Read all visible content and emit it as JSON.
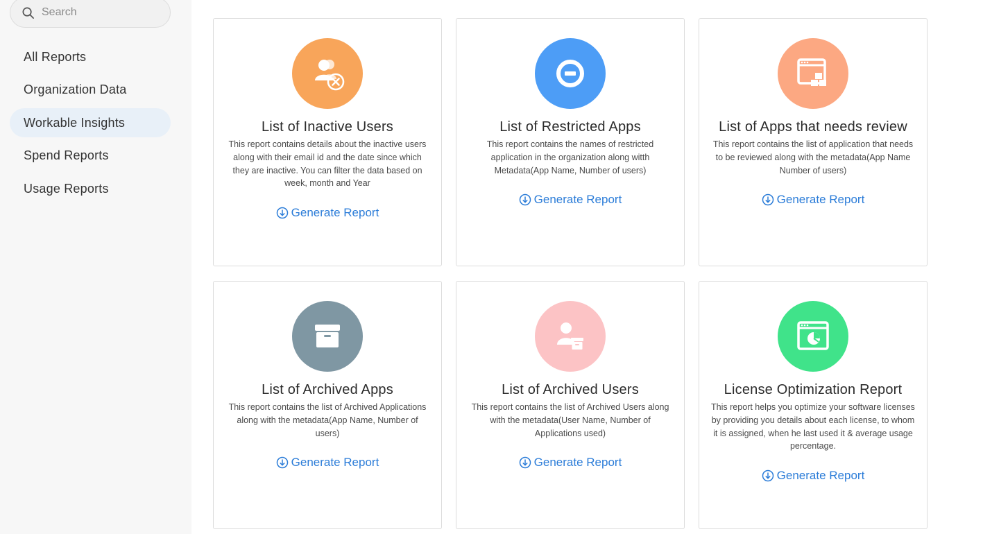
{
  "search": {
    "placeholder": "Search"
  },
  "sidebar": {
    "items": [
      {
        "label": "All Reports"
      },
      {
        "label": "Organization Data"
      },
      {
        "label": "Workable Insights"
      },
      {
        "label": "Spend Reports"
      },
      {
        "label": "Usage Reports"
      }
    ],
    "active_item": "Workable Insights"
  },
  "reports": [
    {
      "title": "List of Inactive Users",
      "description": "This report contains details about the inactive users along with their email id and the date since which they are inactive. You can filter the data based on week, month and Year",
      "action": "Generate Report",
      "icon": "users-remove-icon",
      "color": "#f8a55a"
    },
    {
      "title": "List of Restricted Apps",
      "description": "This report contains the names of restricted application in the organization along witth Metadata(App Name, Number of users)",
      "action": "Generate Report",
      "icon": "restricted-icon",
      "color": "#4d9df6"
    },
    {
      "title": "List of Apps that needs review",
      "description": "This report contains the list of application that needs to be reviewed along with the metadata(App Name Number of users)",
      "action": "Generate Report",
      "icon": "app-window-review-icon",
      "color": "#fca882"
    },
    {
      "title": "List of Archived Apps",
      "description": "This report contains the list of Archived Applications along with the metadata(App Name, Number of users)",
      "action": "Generate Report",
      "icon": "archive-box-icon",
      "color": "#7f97a3"
    },
    {
      "title": "List of Archived Users",
      "description": "This report contains the list of Archived Users along with the metadata(User Name, Number of Applications used)",
      "action": "Generate Report",
      "icon": "archived-user-icon",
      "color": "#fcc3c5"
    },
    {
      "title": "License Optimization Report",
      "description": "This report helps you optimize your software licenses by providing you details about each license, to whom it is assigned, when he last used it & average usage percentage.",
      "action": "Generate Report",
      "icon": "license-chart-icon",
      "color": "#40e38a"
    }
  ]
}
